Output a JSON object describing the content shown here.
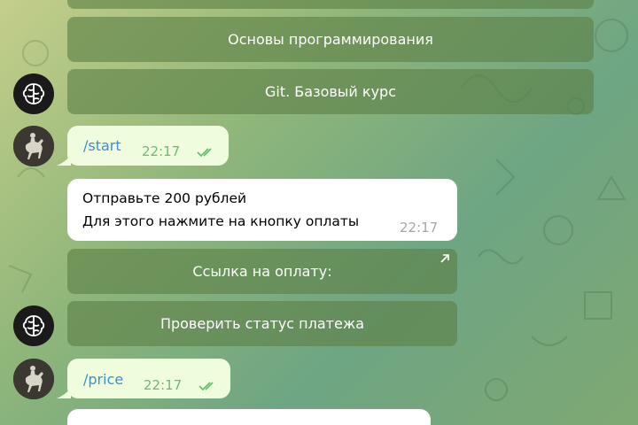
{
  "keyboard_top": {
    "buttons": [
      {
        "label": ""
      },
      {
        "label": "Основы программирования"
      },
      {
        "label": "Git. Базовый курс"
      }
    ]
  },
  "messages": [
    {
      "type": "out",
      "text": "/start",
      "time": "22:17"
    },
    {
      "type": "in",
      "lines": [
        "Отправьте 200 рублей",
        "Для этого нажмите на кнопку оплаты"
      ],
      "time": "22:17"
    },
    {
      "type": "out",
      "text": "/price",
      "time": "22:17"
    }
  ],
  "keyboard_payment": {
    "pay_link_label": "Ссылка на оплату:",
    "check_status_label": "Проверить статус платежа"
  },
  "icons": {
    "external_link": "external-link-icon",
    "read_checks": "double-check-icon",
    "bot_avatar": "brain-icon",
    "user_avatar": "horse-rider-icon"
  },
  "colors": {
    "link": "#3a8fd6",
    "outgoing_bubble": "#effdde",
    "incoming_bubble": "#ffffff",
    "time_out": "#6fba75",
    "time_in": "#a0a7ad"
  }
}
